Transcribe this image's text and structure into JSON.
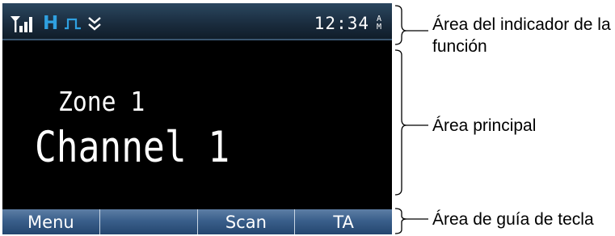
{
  "status_bar": {
    "icons": [
      "signal-strength-icon",
      "mode-h-icon",
      "pulse-icon",
      "double-chevron-down-icon"
    ],
    "mode_letter": "H",
    "time": "12:34",
    "ampm": "A\nM"
  },
  "main": {
    "zone": "Zone 1",
    "channel": "Channel 1"
  },
  "key_bar": {
    "keys": [
      "Menu",
      "",
      "Scan",
      "TA"
    ]
  },
  "callouts": {
    "function_area": "Área del indicador de la función",
    "main_area": "Área principal",
    "key_guide_area": "Área de guía de tecla"
  },
  "colors": {
    "screen_bg": "#000000",
    "mode_accent": "#2fa0e0",
    "status_bar_bg": "#1f3346",
    "key_bar_bg": "#3a5f8b"
  }
}
